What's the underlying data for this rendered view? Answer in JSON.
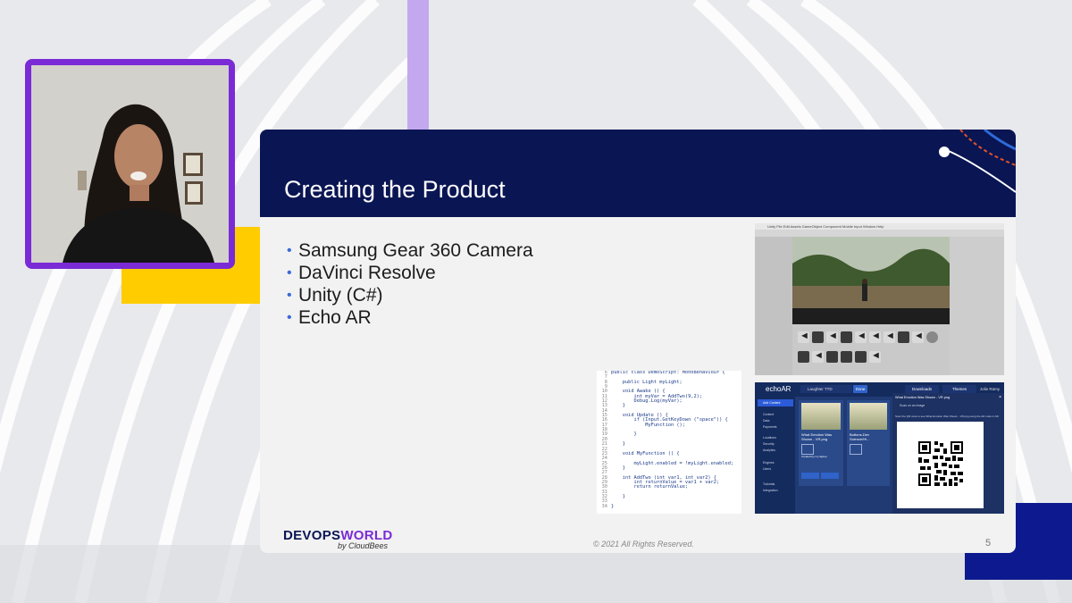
{
  "slide": {
    "title": "Creating the Product",
    "bullets": [
      "Samsung Gear 360 Camera",
      "DaVinci Resolve",
      "Unity (C#)",
      "Echo AR"
    ],
    "logo_main_1": "DEVOPS",
    "logo_main_2": "WORLD",
    "logo_sub": "by CloudBees",
    "copyright": "© 2021 All Rights Reserved.",
    "page_number": "5"
  },
  "code": {
    "lines": [
      {
        "n": "6",
        "t": "public class DemoScript: MonoBehaviour {"
      },
      {
        "n": "7",
        "t": ""
      },
      {
        "n": "8",
        "t": "    public Light myLight;"
      },
      {
        "n": "9",
        "t": ""
      },
      {
        "n": "10",
        "t": "    void Awake () {"
      },
      {
        "n": "11",
        "t": "        int myVar = AddTwo(9,2);"
      },
      {
        "n": "12",
        "t": "        Debug.Log(myVar);"
      },
      {
        "n": "13",
        "t": "    }"
      },
      {
        "n": "14",
        "t": ""
      },
      {
        "n": "15",
        "t": "    void Update () {"
      },
      {
        "n": "16",
        "t": "        if (Input.GetKeyDown (\"space\")) {"
      },
      {
        "n": "17",
        "t": "            MyFunction ();"
      },
      {
        "n": "18",
        "t": ""
      },
      {
        "n": "19",
        "t": "        }"
      },
      {
        "n": "20",
        "t": ""
      },
      {
        "n": "21",
        "t": "    }"
      },
      {
        "n": "22",
        "t": ""
      },
      {
        "n": "23",
        "t": "    void MyFunction () {"
      },
      {
        "n": "24",
        "t": ""
      },
      {
        "n": "25",
        "t": "        myLight.enabled = !myLight.enabled;"
      },
      {
        "n": "26",
        "t": "    }"
      },
      {
        "n": "27",
        "t": ""
      },
      {
        "n": "28",
        "t": "    int AddTwo (int var1, int var2) {"
      },
      {
        "n": "29",
        "t": "        int returnValue = var1 + var2;"
      },
      {
        "n": "30",
        "t": "        return returnValue;"
      },
      {
        "n": "31",
        "t": ""
      },
      {
        "n": "32",
        "t": "    }"
      },
      {
        "n": "33",
        "t": ""
      },
      {
        "n": "34",
        "t": "}"
      }
    ]
  },
  "echo": {
    "logo": "echoAR",
    "search_value": "Laughter TTD",
    "top_buttons": [
      "Done",
      "Downloads",
      "Themes"
    ],
    "user": "Jolie Ramy",
    "new_button": "Add Content",
    "nav": [
      "Content",
      "Data",
      "Payments",
      "Locations",
      "Security",
      "Analytics",
      "Engines",
      "Users",
      "Tutorials",
      "Integration"
    ],
    "cards": [
      {
        "title": "What Emotion Was Shown - VR.png",
        "sub": "Created by my laptop"
      },
      {
        "title": "Buttons-Dev Science/Hi..."
      }
    ],
    "card_actions": [
      "OPEN/EDIT",
      "CONFIGURE"
    ],
    "modal_title": "What Emotion Was Shown - VR.png",
    "modal_tab": "Scan on an image",
    "modal_desc": "Scan the QR code to see What Emotion Was Shown - VR.png using the AR code in AR"
  },
  "unity": {
    "menu": "Unity  File  Edit  Assets  GameObject  Component  Mobile Input  Window  Help"
  },
  "colors": {
    "header": "#0a1553",
    "accent_purple": "#7a2bd6",
    "accent_yellow": "#ffcc00",
    "accent_navy": "#0d1a8f"
  }
}
